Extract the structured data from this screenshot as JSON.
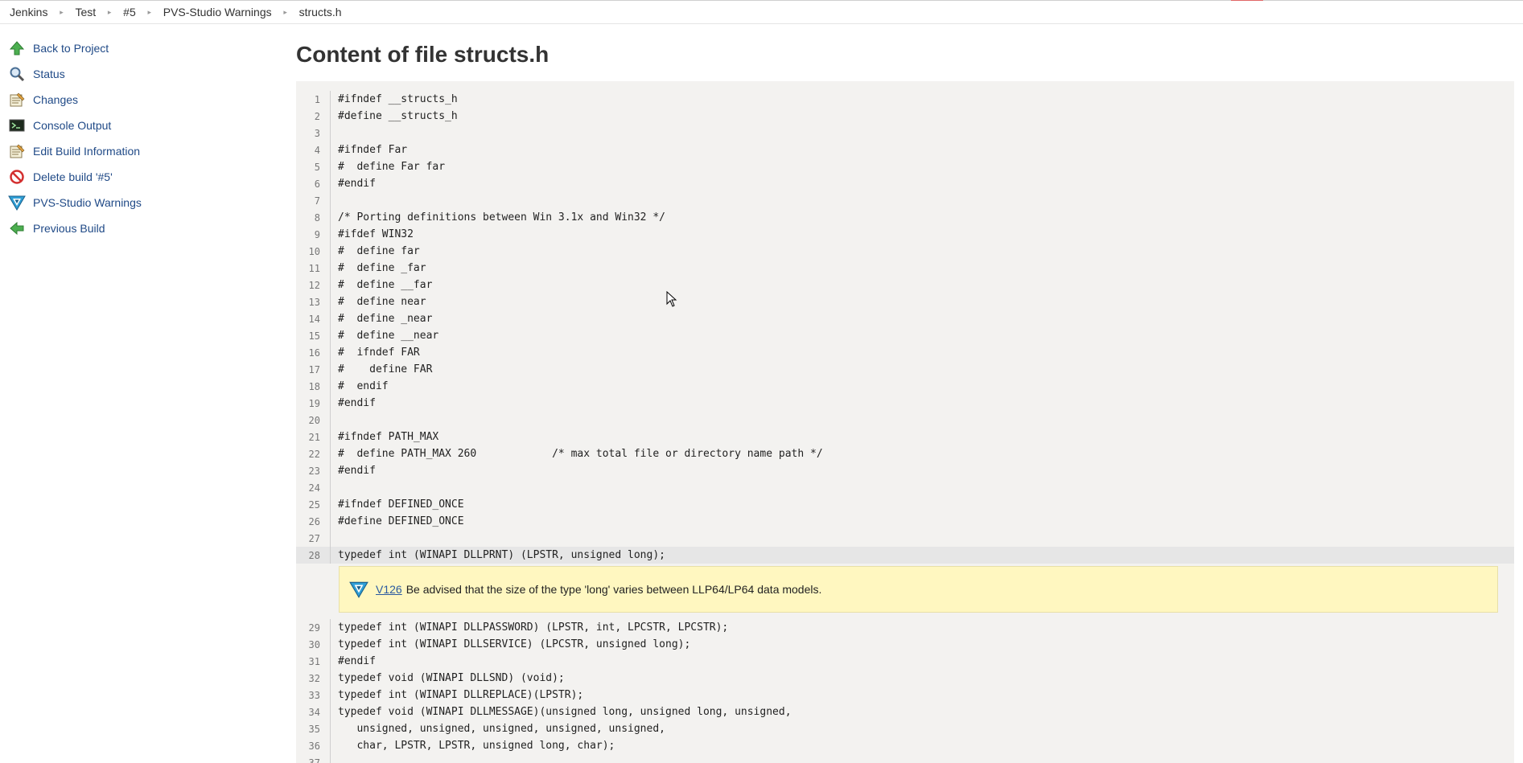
{
  "breadcrumb": [
    "Jenkins",
    "Test",
    "#5",
    "PVS-Studio Warnings",
    "structs.h"
  ],
  "sidebar": {
    "items": [
      {
        "label": "Back to Project",
        "icon": "up-arrow-icon"
      },
      {
        "label": "Status",
        "icon": "magnifier-icon"
      },
      {
        "label": "Changes",
        "icon": "notepad-icon"
      },
      {
        "label": "Console Output",
        "icon": "terminal-icon"
      },
      {
        "label": "Edit Build Information",
        "icon": "notepad-edit-icon"
      },
      {
        "label": "Delete build '#5'",
        "icon": "no-entry-icon"
      },
      {
        "label": "PVS-Studio Warnings",
        "icon": "pvs-studio-icon"
      },
      {
        "label": "Previous Build",
        "icon": "left-arrow-icon"
      }
    ]
  },
  "main": {
    "title": "Content of file structs.h",
    "lines_before": [
      {
        "n": "1",
        "t": "#ifndef __structs_h"
      },
      {
        "n": "2",
        "t": "#define __structs_h"
      },
      {
        "n": "3",
        "t": ""
      },
      {
        "n": "4",
        "t": "#ifndef Far"
      },
      {
        "n": "5",
        "t": "#  define Far far"
      },
      {
        "n": "6",
        "t": "#endif"
      },
      {
        "n": "7",
        "t": ""
      },
      {
        "n": "8",
        "t": "/* Porting definitions between Win 3.1x and Win32 */"
      },
      {
        "n": "9",
        "t": "#ifdef WIN32"
      },
      {
        "n": "10",
        "t": "#  define far"
      },
      {
        "n": "11",
        "t": "#  define _far"
      },
      {
        "n": "12",
        "t": "#  define __far"
      },
      {
        "n": "13",
        "t": "#  define near"
      },
      {
        "n": "14",
        "t": "#  define _near"
      },
      {
        "n": "15",
        "t": "#  define __near"
      },
      {
        "n": "16",
        "t": "#  ifndef FAR"
      },
      {
        "n": "17",
        "t": "#    define FAR"
      },
      {
        "n": "18",
        "t": "#  endif"
      },
      {
        "n": "19",
        "t": "#endif"
      },
      {
        "n": "20",
        "t": ""
      },
      {
        "n": "21",
        "t": "#ifndef PATH_MAX"
      },
      {
        "n": "22",
        "t": "#  define PATH_MAX 260            /* max total file or directory name path */"
      },
      {
        "n": "23",
        "t": "#endif"
      },
      {
        "n": "24",
        "t": ""
      },
      {
        "n": "25",
        "t": "#ifndef DEFINED_ONCE"
      },
      {
        "n": "26",
        "t": "#define DEFINED_ONCE"
      },
      {
        "n": "27",
        "t": ""
      },
      {
        "n": "28",
        "t": "typedef int (WINAPI DLLPRNT) (LPSTR, unsigned long);"
      }
    ],
    "warning": {
      "code": "V126",
      "message": "Be advised that the size of the type 'long' varies between LLP64/LP64 data models.",
      "icon": "pvs-studio-icon"
    },
    "lines_after": [
      {
        "n": "29",
        "t": "typedef int (WINAPI DLLPASSWORD) (LPSTR, int, LPCSTR, LPCSTR);"
      },
      {
        "n": "30",
        "t": "typedef int (WINAPI DLLSERVICE) (LPCSTR, unsigned long);"
      },
      {
        "n": "31",
        "t": "#endif"
      },
      {
        "n": "32",
        "t": "typedef void (WINAPI DLLSND) (void);"
      },
      {
        "n": "33",
        "t": "typedef int (WINAPI DLLREPLACE)(LPSTR);"
      },
      {
        "n": "34",
        "t": "typedef void (WINAPI DLLMESSAGE)(unsigned long, unsigned long, unsigned,"
      },
      {
        "n": "35",
        "t": "   unsigned, unsigned, unsigned, unsigned, unsigned,"
      },
      {
        "n": "36",
        "t": "   char, LPSTR, LPSTR, unsigned long, char);"
      },
      {
        "n": "37",
        "t": ""
      }
    ]
  }
}
